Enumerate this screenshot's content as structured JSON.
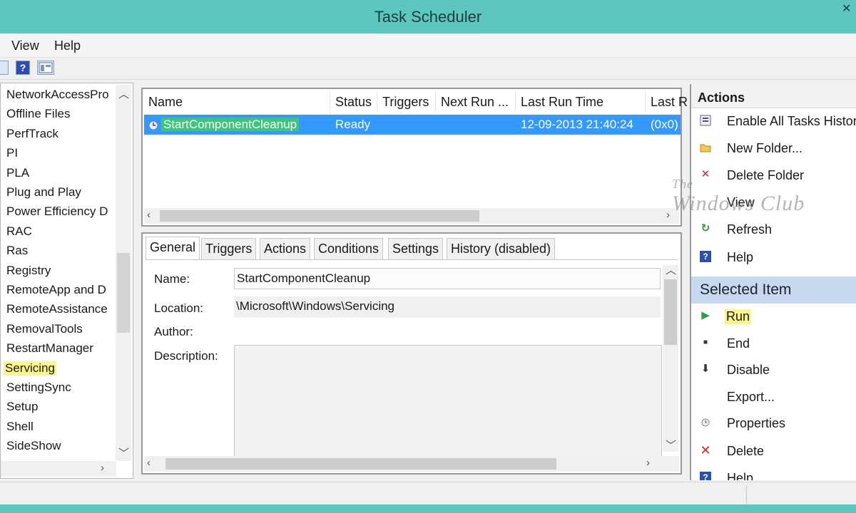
{
  "window": {
    "title": "Task Scheduler"
  },
  "menu": {
    "view": "View",
    "help": "Help"
  },
  "toolbar": {
    "help_glyph": "?"
  },
  "tree": {
    "items": [
      "NetworkAccessPro",
      "Offline Files",
      "PerfTrack",
      "PI",
      "PLA",
      "Plug and Play",
      "Power Efficiency D",
      "RAC",
      "Ras",
      "Registry",
      "RemoteApp and D",
      "RemoteAssistance",
      "RemovalTools",
      "RestartManager",
      "Servicing",
      "SettingSync",
      "Setup",
      "Shell",
      "SideShow"
    ],
    "selected": "Servicing"
  },
  "tasklist": {
    "columns": [
      "Name",
      "Status",
      "Triggers",
      "Next Run ...",
      "Last Run Time",
      "Last R"
    ],
    "rows": [
      {
        "name": "StartComponentCleanup",
        "status": "Ready",
        "triggers": "",
        "next_run": "",
        "last_run": "12-09-2013 21:40:24",
        "last_result": "(0x0)"
      }
    ]
  },
  "detail": {
    "tabs": [
      "General",
      "Triggers",
      "Actions",
      "Conditions",
      "Settings",
      "History (disabled)"
    ],
    "active_tab": "General",
    "fields": {
      "name_label": "Name:",
      "name_value": "StartComponentCleanup",
      "location_label": "Location:",
      "location_value": "\\Microsoft\\Windows\\Servicing",
      "author_label": "Author:",
      "description_label": "Description:"
    }
  },
  "actions": {
    "header": "Actions",
    "items": [
      "Enable All Tasks History",
      "New Folder...",
      "Delete Folder",
      "View",
      "Refresh",
      "Help"
    ],
    "selected_header": "Selected Item",
    "selected_items": [
      "Run",
      "End",
      "Disable",
      "Export...",
      "Properties",
      "Delete",
      "Help"
    ]
  },
  "watermark": {
    "line1": "The",
    "line2": "Windows Club"
  },
  "colors": {
    "titlebar": "#5cc6bf",
    "selection": "#3399ff",
    "highlight": "#faf68a",
    "selected_header": "#c6d9ef"
  },
  "icons": [
    "close-icon",
    "toolbar-folder-icon",
    "help-icon",
    "toolbar-view-icon",
    "clock-icon",
    "history-icon",
    "folder-icon",
    "delete-x-icon",
    "refresh-icon",
    "play-icon",
    "stop-icon",
    "down-arrow-icon",
    "properties-icon"
  ]
}
